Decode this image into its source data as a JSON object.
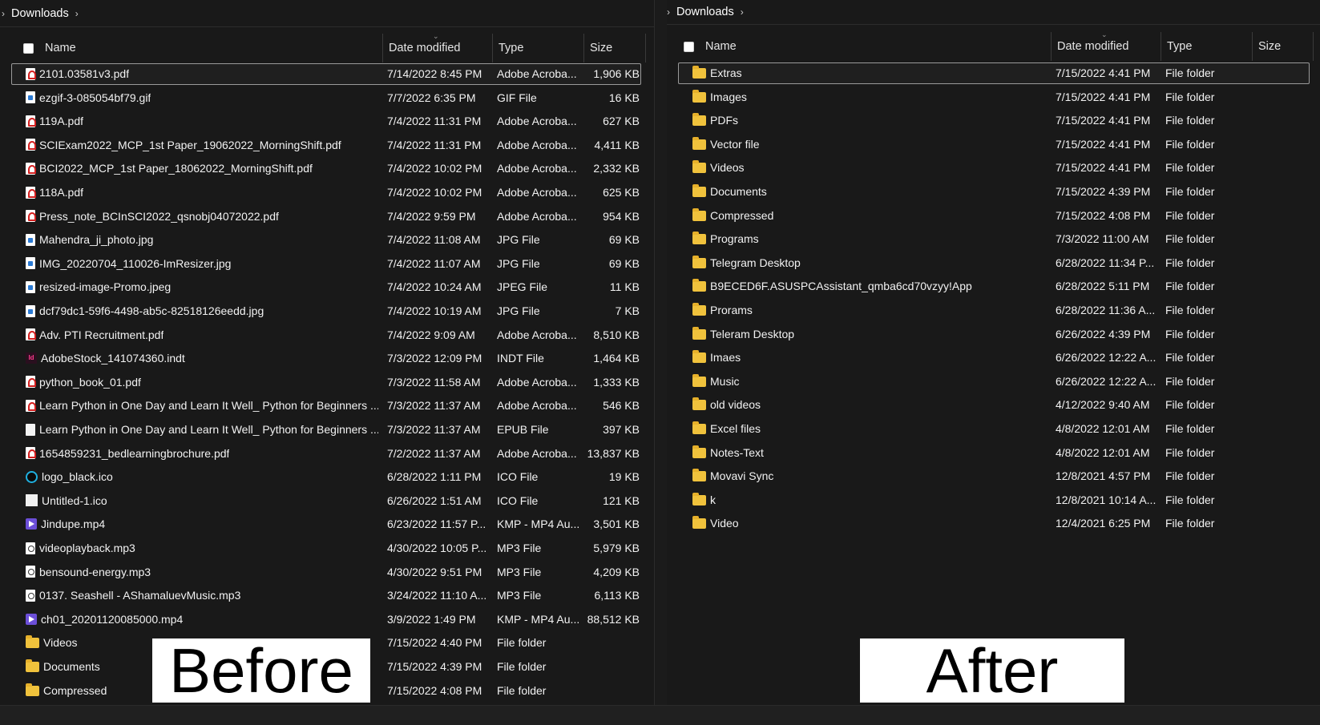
{
  "left": {
    "breadcrumb": {
      "chevron": "›",
      "label": "Downloads",
      "after": "›"
    },
    "columns": {
      "name": "Name",
      "date": "Date modified",
      "type": "Type",
      "size": "Size"
    },
    "rows": [
      {
        "icon": "pdf-icon",
        "name": "2101.03581v3.pdf",
        "date": "7/14/2022 8:45 PM",
        "type": "Adobe Acroba...",
        "size": "1,906 KB"
      },
      {
        "icon": "image-file-icon",
        "name": "ezgif-3-085054bf79.gif",
        "date": "7/7/2022 6:35 PM",
        "type": "GIF File",
        "size": "16 KB"
      },
      {
        "icon": "pdf-icon",
        "name": "119A.pdf",
        "date": "7/4/2022 11:31 PM",
        "type": "Adobe Acroba...",
        "size": "627 KB"
      },
      {
        "icon": "pdf-icon",
        "name": "SCIExam2022_MCP_1st Paper_19062022_MorningShift.pdf",
        "date": "7/4/2022 11:31 PM",
        "type": "Adobe Acroba...",
        "size": "4,411 KB"
      },
      {
        "icon": "pdf-icon",
        "name": "BCI2022_MCP_1st Paper_18062022_MorningShift.pdf",
        "date": "7/4/2022 10:02 PM",
        "type": "Adobe Acroba...",
        "size": "2,332 KB"
      },
      {
        "icon": "pdf-icon",
        "name": "118A.pdf",
        "date": "7/4/2022 10:02 PM",
        "type": "Adobe Acroba...",
        "size": "625 KB"
      },
      {
        "icon": "pdf-icon",
        "name": "Press_note_BCInSCI2022_qsnobj04072022.pdf",
        "date": "7/4/2022 9:59 PM",
        "type": "Adobe Acroba...",
        "size": "954 KB"
      },
      {
        "icon": "image-file-icon",
        "name": "Mahendra_ji_photo.jpg",
        "date": "7/4/2022 11:08 AM",
        "type": "JPG File",
        "size": "69 KB"
      },
      {
        "icon": "image-file-icon",
        "name": "IMG_20220704_110026-ImResizer.jpg",
        "date": "7/4/2022 11:07 AM",
        "type": "JPG File",
        "size": "69 KB"
      },
      {
        "icon": "image-file-icon",
        "name": "resized-image-Promo.jpeg",
        "date": "7/4/2022 10:24 AM",
        "type": "JPEG File",
        "size": "11 KB"
      },
      {
        "icon": "image-file-icon",
        "name": "dcf79dc1-59f6-4498-ab5c-82518126eedd.jpg",
        "date": "7/4/2022 10:19 AM",
        "type": "JPG File",
        "size": "7 KB"
      },
      {
        "icon": "pdf-icon",
        "name": "Adv. PTI Recruitment.pdf",
        "date": "7/4/2022 9:09 AM",
        "type": "Adobe Acroba...",
        "size": "8,510 KB"
      },
      {
        "icon": "indesign-icon",
        "name": "AdobeStock_141074360.indt",
        "date": "7/3/2022 12:09 PM",
        "type": "INDT File",
        "size": "1,464 KB"
      },
      {
        "icon": "pdf-icon",
        "name": "python_book_01.pdf",
        "date": "7/3/2022 11:58 AM",
        "type": "Adobe Acroba...",
        "size": "1,333 KB"
      },
      {
        "icon": "pdf-icon",
        "name": "Learn Python in One Day and Learn It Well_ Python for Beginners ...",
        "date": "7/3/2022 11:37 AM",
        "type": "Adobe Acroba...",
        "size": "546 KB"
      },
      {
        "icon": "document-icon",
        "name": "Learn Python in One Day and Learn It Well_ Python for Beginners ...",
        "date": "7/3/2022 11:37 AM",
        "type": "EPUB File",
        "size": "397 KB"
      },
      {
        "icon": "pdf-icon",
        "name": "1654859231_bedlearningbrochure.pdf",
        "date": "7/2/2022 11:37 AM",
        "type": "Adobe Acroba...",
        "size": "13,837 KB"
      },
      {
        "icon": "logo-ico-icon",
        "name": "logo_black.ico",
        "date": "6/28/2022 1:11 PM",
        "type": "ICO File",
        "size": "19 KB"
      },
      {
        "icon": "ico-file-icon",
        "name": "Untitled-1.ico",
        "date": "6/26/2022 1:51 AM",
        "type": "ICO File",
        "size": "121 KB"
      },
      {
        "icon": "video-file-icon",
        "name": "Jindupe.mp4",
        "date": "6/23/2022 11:57 P...",
        "type": "KMP - MP4 Au...",
        "size": "3,501 KB"
      },
      {
        "icon": "audio-file-icon",
        "name": "videoplayback.mp3",
        "date": "4/30/2022 10:05 P...",
        "type": "MP3 File",
        "size": "5,979 KB"
      },
      {
        "icon": "audio-file-icon",
        "name": "bensound-energy.mp3",
        "date": "4/30/2022 9:51 PM",
        "type": "MP3 File",
        "size": "4,209 KB"
      },
      {
        "icon": "audio-file-icon",
        "name": "0137. Seashell - AShamaluevMusic.mp3",
        "date": "3/24/2022 11:10 A...",
        "type": "MP3 File",
        "size": "6,113 KB"
      },
      {
        "icon": "video-file-icon",
        "name": "ch01_20201120085000.mp4",
        "date": "3/9/2022 1:49 PM",
        "type": "KMP - MP4 Au...",
        "size": "88,512 KB"
      },
      {
        "icon": "folder-icon",
        "name": "Videos",
        "date": "7/15/2022 4:40 PM",
        "type": "File folder",
        "size": ""
      },
      {
        "icon": "folder-icon",
        "name": "Documents",
        "date": "7/15/2022 4:39 PM",
        "type": "File folder",
        "size": ""
      },
      {
        "icon": "folder-icon",
        "name": "Compressed",
        "date": "7/15/2022 4:08 PM",
        "type": "File folder",
        "size": ""
      }
    ],
    "overlay_label": "Before"
  },
  "right": {
    "breadcrumb": {
      "chevron": "›",
      "label": "Downloads",
      "after": "›"
    },
    "columns": {
      "name": "Name",
      "date": "Date modified",
      "type": "Type",
      "size": "Size"
    },
    "rows": [
      {
        "icon": "folder-icon",
        "name": "Extras",
        "date": "7/15/2022 4:41 PM",
        "type": "File folder"
      },
      {
        "icon": "folder-icon",
        "name": "Images",
        "date": "7/15/2022 4:41 PM",
        "type": "File folder"
      },
      {
        "icon": "folder-icon",
        "name": "PDFs",
        "date": "7/15/2022 4:41 PM",
        "type": "File folder"
      },
      {
        "icon": "folder-icon",
        "name": "Vector file",
        "date": "7/15/2022 4:41 PM",
        "type": "File folder"
      },
      {
        "icon": "folder-icon",
        "name": "Videos",
        "date": "7/15/2022 4:41 PM",
        "type": "File folder"
      },
      {
        "icon": "folder-icon",
        "name": "Documents",
        "date": "7/15/2022 4:39 PM",
        "type": "File folder"
      },
      {
        "icon": "folder-icon",
        "name": "Compressed",
        "date": "7/15/2022 4:08 PM",
        "type": "File folder"
      },
      {
        "icon": "folder-icon",
        "name": "Programs",
        "date": "7/3/2022 11:00 AM",
        "type": "File folder"
      },
      {
        "icon": "folder-icon",
        "name": "Telegram Desktop",
        "date": "6/28/2022 11:34 P...",
        "type": "File folder"
      },
      {
        "icon": "folder-icon",
        "name": "B9ECED6F.ASUSPCAssistant_qmba6cd70vzyy!App",
        "date": "6/28/2022 5:11 PM",
        "type": "File folder"
      },
      {
        "icon": "folder-icon",
        "name": "Prorams",
        "date": "6/28/2022 11:36 A...",
        "type": "File folder"
      },
      {
        "icon": "folder-icon",
        "name": "Teleram Desktop",
        "date": "6/26/2022 4:39 PM",
        "type": "File folder"
      },
      {
        "icon": "folder-icon",
        "name": "Imaes",
        "date": "6/26/2022 12:22 A...",
        "type": "File folder"
      },
      {
        "icon": "folder-icon",
        "name": "Music",
        "date": "6/26/2022 12:22 A...",
        "type": "File folder"
      },
      {
        "icon": "folder-icon",
        "name": "old videos",
        "date": "4/12/2022 9:40 AM",
        "type": "File folder"
      },
      {
        "icon": "folder-icon",
        "name": "Excel files",
        "date": "4/8/2022 12:01 AM",
        "type": "File folder"
      },
      {
        "icon": "folder-icon",
        "name": "Notes-Text",
        "date": "4/8/2022 12:01 AM",
        "type": "File folder"
      },
      {
        "icon": "folder-icon",
        "name": "Movavi Sync",
        "date": "12/8/2021 4:57 PM",
        "type": "File folder"
      },
      {
        "icon": "folder-icon",
        "name": "k",
        "date": "12/8/2021 10:14 A...",
        "type": "File folder"
      },
      {
        "icon": "folder-icon",
        "name": "Video",
        "date": "12/4/2021 6:25 PM",
        "type": "File folder"
      }
    ],
    "overlay_label": "After"
  }
}
